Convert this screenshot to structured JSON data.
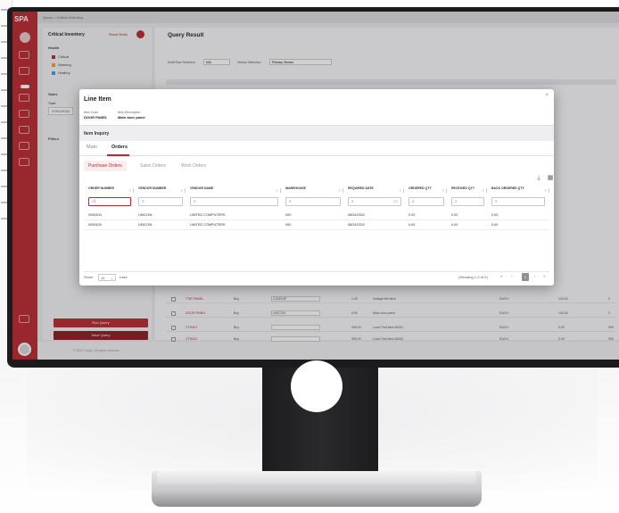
{
  "app": {
    "logo": "SPA",
    "breadcrumb": "Query  >  Critical Inventory",
    "footer": "© 2022 Sculpi. All rights reserved."
  },
  "left_panel": {
    "title": "Critical Inventory",
    "link": "Reset fields",
    "section_label": "Health",
    "legend": [
      {
        "label": "Critical",
        "color": "#b8282e"
      },
      {
        "label": "Warning",
        "color": "#e8a23a"
      },
      {
        "label": "Healthy",
        "color": "#3aa0d8"
      }
    ],
    "sales_label": "Sales",
    "start_label": "Start",
    "start_value": "07/01/2022",
    "filters_label": "Filters",
    "run_button": "Run Query",
    "save_button": "Save Query"
  },
  "main": {
    "title": "Query Result",
    "toolbar_label": "Multi-Row Selection",
    "toolbar_value": "N/A",
    "vendor_label": "Vendor Selection",
    "vendor_value": "Primary Vendor",
    "bg_rows": [
      {
        "item": "7TAT-PANEL",
        "method": "Buy",
        "vendor": "COMSUP",
        "qty": "1.00",
        "desc": "Voltage left latch",
        "code": "EACH",
        "cost": "120.00",
        "avail": "0"
      },
      {
        "item": "DOOR PANEL",
        "method": "Buy",
        "vendor": "UNICOM",
        "qty": "0.00",
        "desc": "Main door panel",
        "code": "EACH",
        "cost": "100.00",
        "avail": "0"
      },
      {
        "item": "CTH001",
        "method": "Buy",
        "vendor": "",
        "qty": "999.00",
        "desc": "Load That Item 00001",
        "code": "EACH",
        "cost": "0.00",
        "avail": "999"
      },
      {
        "item": "CTH002",
        "method": "Buy",
        "vendor": "",
        "qty": "999.00",
        "desc": "Load That Item 00002",
        "code": "EACH",
        "cost": "0.00",
        "avail": "999"
      }
    ]
  },
  "modal": {
    "title": "Line Item",
    "item_code_label": "Item Code",
    "item_code_value": "DOOR PANEL",
    "item_desc_label": "Item Description",
    "item_desc_value": "Main door panel",
    "inquiry_label": "Item Inquiry",
    "tabs": [
      "Main",
      "Orders"
    ],
    "active_tab": "Orders",
    "subtabs": [
      "Purchase Orders",
      "Sales Orders",
      "Work Orders"
    ],
    "active_subtab": "Purchase Orders",
    "columns": [
      "ORDER NUMBER",
      "VENDOR NUMBER",
      "VENDOR NAME",
      "WAREHOUSE",
      "REQUIRED DATE",
      "ORDERED QTY",
      "RECEIVED QTY",
      "BACK ORDERED QTY"
    ],
    "rows": [
      {
        "order_number": "0095100",
        "vendor_number": "UNICOM",
        "vendor_name": "UNITED COMPUTERS",
        "warehouse": "000",
        "required_date": "08/24/2022",
        "ordered_qty": "0.00",
        "received_qty": "0.00",
        "back_ordered_qty": "0.00"
      },
      {
        "order_number": "0095105",
        "vendor_number": "UNICOM",
        "vendor_name": "UNITED COMPUTERS",
        "warehouse": "000",
        "required_date": "08/24/2022",
        "ordered_qty": "0.00",
        "received_qty": "0.00",
        "back_ordered_qty": "0.00"
      }
    ],
    "pager": {
      "show_label": "Show",
      "page_size": "10",
      "rows_label": "rows",
      "summary": "(Showing 1-2 of 2)",
      "current_page": "1"
    }
  }
}
